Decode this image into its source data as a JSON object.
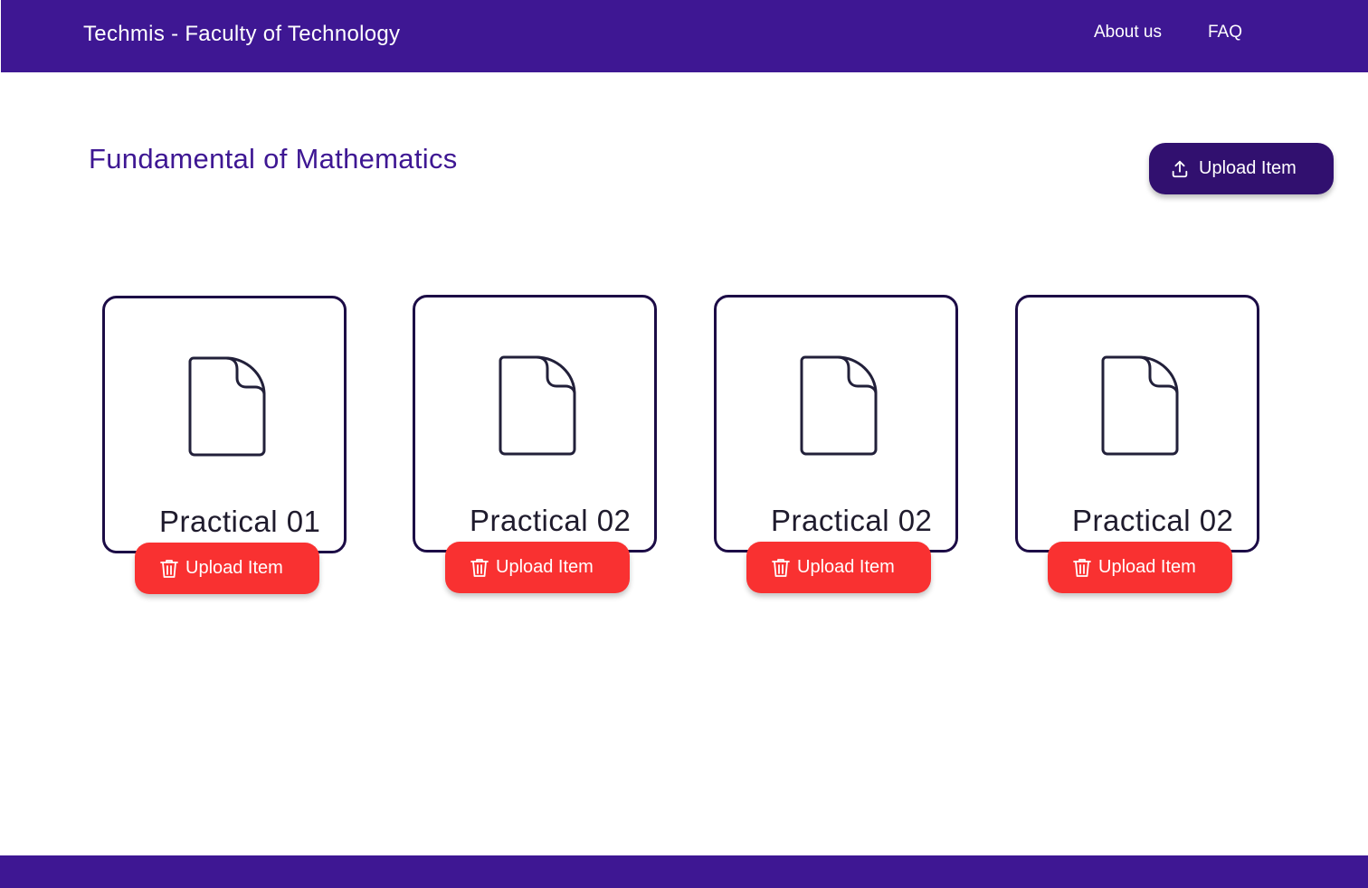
{
  "header": {
    "brand": "Techmis - Faculty of Technology",
    "nav": [
      {
        "label": "About us"
      },
      {
        "label": "FAQ"
      }
    ]
  },
  "main": {
    "title": "Fundamental of Mathematics",
    "upload_button": {
      "label": "Upload Item",
      "icon": "upload-icon"
    }
  },
  "items": [
    {
      "title": "Practical 01",
      "icon": "document-icon",
      "action_label": "Upload Item",
      "action_icon": "trash-icon"
    },
    {
      "title": "Practical 02",
      "icon": "document-icon",
      "action_label": "Upload Item",
      "action_icon": "trash-icon"
    },
    {
      "title": "Practical 02",
      "icon": "document-icon",
      "action_label": "Upload Item",
      "action_icon": "trash-icon"
    },
    {
      "title": "Practical 02",
      "icon": "document-icon",
      "action_label": "Upload Item",
      "action_icon": "trash-icon"
    }
  ],
  "colors": {
    "brand": "#3e1793",
    "primary_button": "#31106f",
    "danger_button": "#f93131",
    "card_border": "#1c0c46"
  }
}
